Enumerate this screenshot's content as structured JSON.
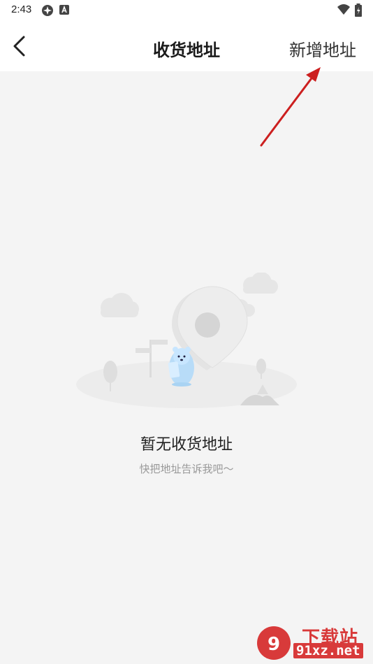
{
  "status_bar": {
    "time": "2:43"
  },
  "app_bar": {
    "title": "收货地址",
    "add_label": "新增地址"
  },
  "empty_state": {
    "title": "暂无收货地址",
    "subtitle": "快把地址告诉我吧～"
  },
  "watermark": {
    "line1": "下载站",
    "line2": "91xz.net"
  },
  "colors": {
    "arrow": "#cc1f1f",
    "watermark": "#d83a3a"
  }
}
